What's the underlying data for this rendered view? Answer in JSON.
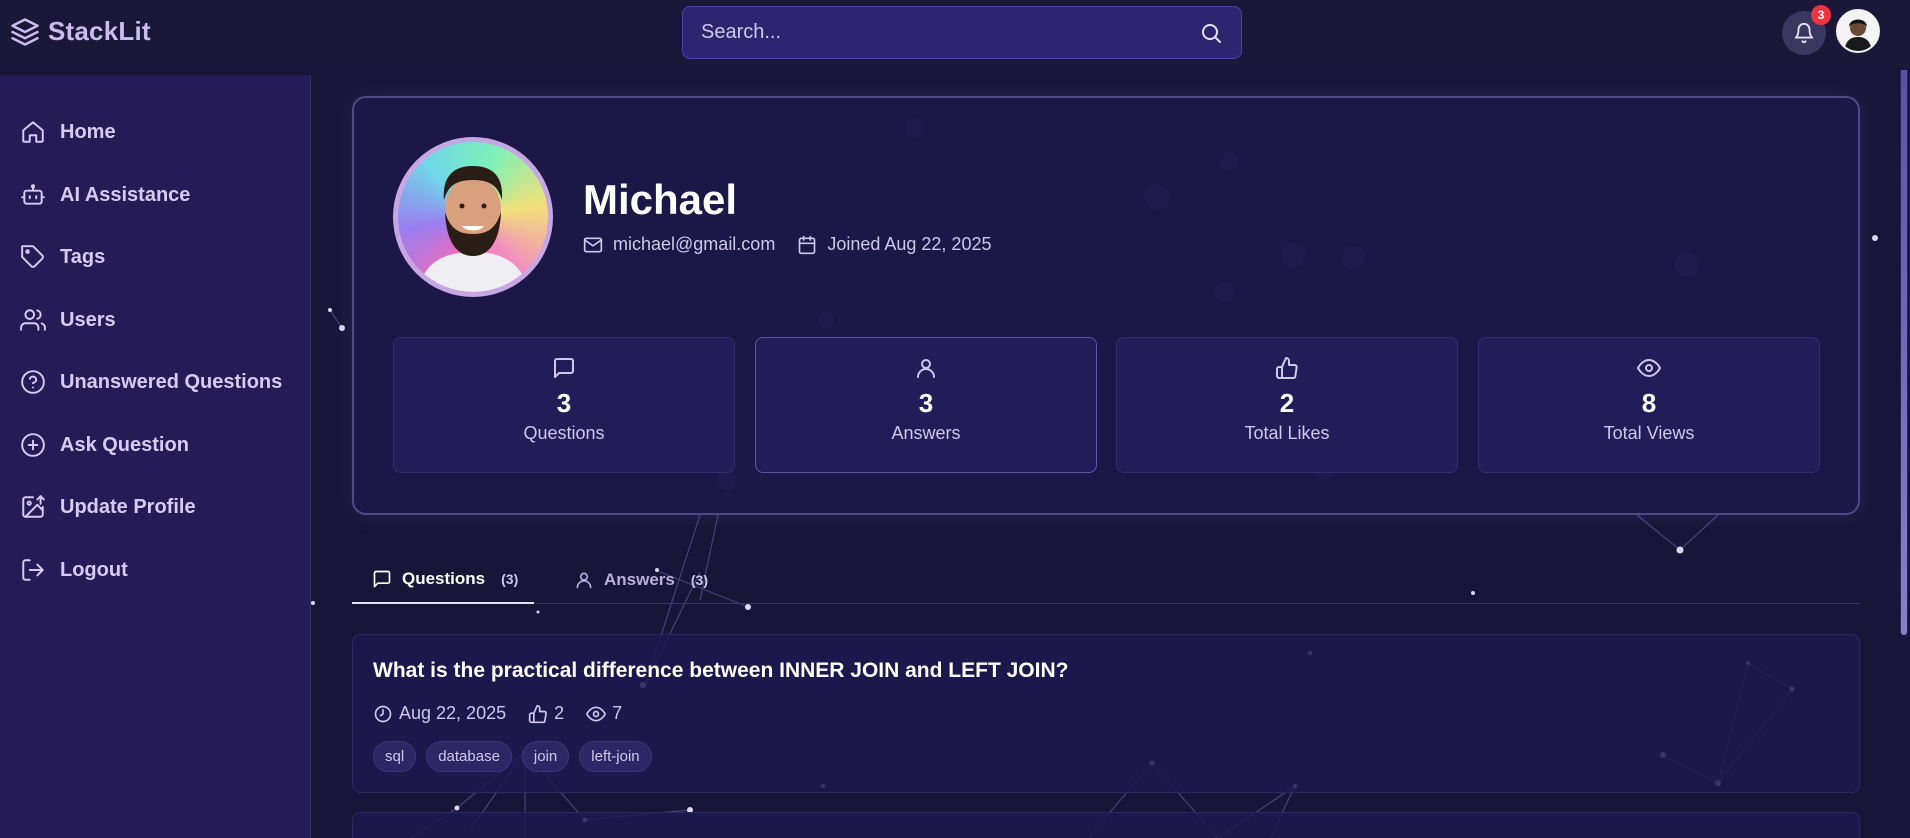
{
  "app": {
    "name": "StackLit"
  },
  "search": {
    "placeholder": "Search..."
  },
  "notifications": {
    "count": "3"
  },
  "sidebar": {
    "items": [
      {
        "label": "Home",
        "icon": "home-icon"
      },
      {
        "label": "AI Assistance",
        "icon": "bot-icon"
      },
      {
        "label": "Tags",
        "icon": "tag-icon"
      },
      {
        "label": "Users",
        "icon": "users-icon"
      },
      {
        "label": "Unanswered Questions",
        "icon": "question-circle-icon"
      },
      {
        "label": "Ask Question",
        "icon": "plus-circle-icon"
      },
      {
        "label": "Update Profile",
        "icon": "image-upload-icon"
      },
      {
        "label": "Logout",
        "icon": "logout-icon"
      }
    ]
  },
  "profile": {
    "name": "Michael",
    "email": "michael@gmail.com",
    "joined": "Joined Aug 22, 2025"
  },
  "stats": [
    {
      "value": "3",
      "label": "Questions",
      "icon": "message-square-icon"
    },
    {
      "value": "3",
      "label": "Answers",
      "icon": "user-icon"
    },
    {
      "value": "2",
      "label": "Total Likes",
      "icon": "thumbs-up-icon"
    },
    {
      "value": "8",
      "label": "Total Views",
      "icon": "eye-icon"
    }
  ],
  "tabs": [
    {
      "label": "Questions",
      "count": "(3)"
    },
    {
      "label": "Answers",
      "count": "(3)"
    }
  ],
  "questions": [
    {
      "title": "What is the practical difference between INNER JOIN and LEFT JOIN?",
      "date": "Aug 22, 2025",
      "likes": "2",
      "views": "7",
      "tags": [
        "sql",
        "database",
        "join",
        "left-join"
      ]
    }
  ],
  "colors": {
    "background": "#181538",
    "sidebar": "#241b57",
    "accent": "#4f40a8",
    "badge": "#ef3340"
  }
}
